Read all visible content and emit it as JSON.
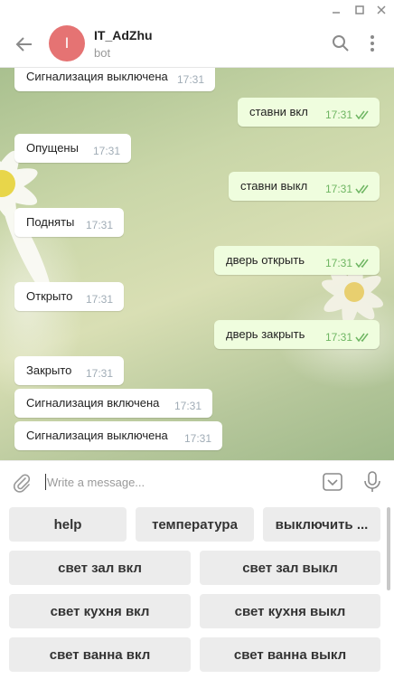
{
  "window": {
    "controls": [
      "minimize-icon",
      "maximize-icon",
      "close-icon"
    ]
  },
  "header": {
    "avatar_letter": "I",
    "avatar_color": "#e57373",
    "title": "IT_AdZhu",
    "subtitle": "bot"
  },
  "messages": [
    {
      "dir": "in",
      "text": "Сигнализация выключена",
      "time": "17:31"
    },
    {
      "dir": "out",
      "text": "ставни вкл",
      "time": "17:31"
    },
    {
      "dir": "in",
      "text": "Опущены",
      "time": "17:31"
    },
    {
      "dir": "out",
      "text": "ставни выкл",
      "time": "17:31"
    },
    {
      "dir": "in",
      "text": "Подняты",
      "time": "17:31"
    },
    {
      "dir": "out",
      "text": "дверь открыть",
      "time": "17:31"
    },
    {
      "dir": "in",
      "text": "Открыто",
      "time": "17:31"
    },
    {
      "dir": "out",
      "text": "дверь закрыть",
      "time": "17:31"
    },
    {
      "dir": "in",
      "text": "Закрыто",
      "time": "17:31"
    },
    {
      "dir": "in",
      "text": "Сигнализация включена",
      "time": "17:31"
    },
    {
      "dir": "in",
      "text": "Сигнализация выключена",
      "time": "17:31"
    }
  ],
  "composer": {
    "placeholder": "Write a message..."
  },
  "keyboard": {
    "row1": [
      "help",
      "температура",
      "выключить ..."
    ],
    "row2": [
      "свет зал вкл",
      "свет зал выкл"
    ],
    "row3": [
      "свет кухня вкл",
      "свет кухня выкл"
    ],
    "row4": [
      "свет ванна вкл",
      "свет ванна выкл"
    ]
  },
  "colors": {
    "outgoing_bubble": "#effdde",
    "read_check": "#6fb663",
    "accent": "#e57373"
  }
}
